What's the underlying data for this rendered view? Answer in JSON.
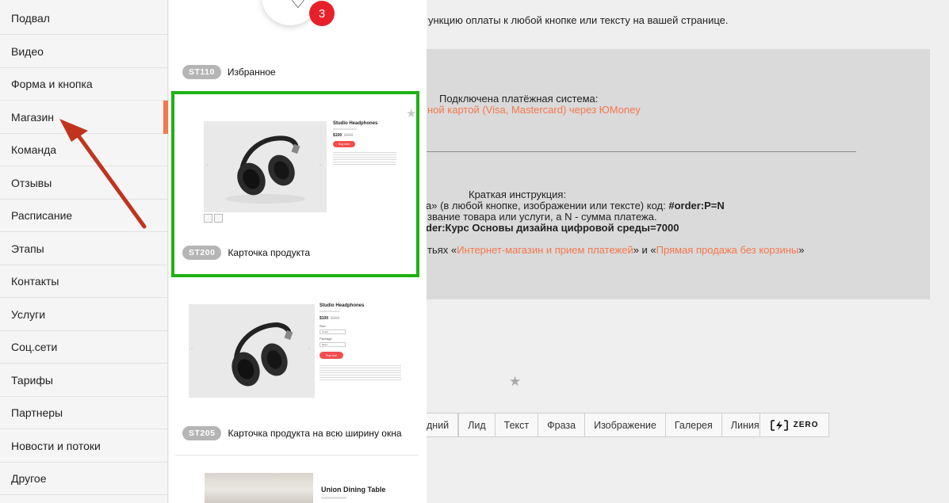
{
  "background_page": {
    "intro": "ункцию оплаты к любой кнопке или тексту на вашей странице.",
    "payment_heading": "Подключена платёжная система:",
    "payment_system": "ной картой (Visa, Mastercard) через ЮMoney",
    "instructions_heading": "Краткая инструкция:",
    "instr_line1_text": "а» (в любой кнопке, изображении или тексте) код: ",
    "instr_line1_code": "#order:P=N",
    "instr_line2": "звание товара или услуги, а N - сумма платежа.",
    "instr_line3": "der:Курс Основы дизайна цифровой среды=7000",
    "instr_line4_prefix": "тьях «",
    "instr_link1": "Интернет-магазин и прием платежей",
    "instr_line4_mid": "» и «",
    "instr_link2": "Прямая продажа без корзины",
    "instr_line4_suffix": "»",
    "toolbar": [
      "дний",
      "Лид",
      "Текст",
      "Фраза",
      "Изображение",
      "Галерея",
      "Линия"
    ],
    "zero_label": "ZERO",
    "accent_color": "#f4774b"
  },
  "sidebar": {
    "active_index": 3,
    "items": [
      "Подвал",
      "Видео",
      "Форма и кнопка",
      "Магазин",
      "Команда",
      "Отзывы",
      "Расписание",
      "Этапы",
      "Контакты",
      "Услуги",
      "Соц.сети",
      "Тарифы",
      "Партнеры",
      "Новости и потоки",
      "Другое"
    ]
  },
  "library": {
    "favorites_count": "3",
    "blocks": [
      {
        "code": "ST110",
        "title": "Избранное"
      },
      {
        "code": "ST200",
        "title": "Карточка продукта",
        "selected": true
      },
      {
        "code": "ST205",
        "title": "Карточка продукта на всю ширину окна"
      }
    ],
    "preview_st200": {
      "product_title": "Studio Headphones",
      "price": "$100",
      "old_price": "$200",
      "button": "Buy now"
    },
    "preview_st205": {
      "product_title": "Studio Headphones",
      "price": "$100",
      "old_price": "$200",
      "label_size": "Size",
      "select_size": "Small",
      "label_package": "Package",
      "select_package": "Basic",
      "button": "Buy now"
    },
    "preview_next": {
      "product_title": "Union Dining Table"
    },
    "selection_color": "#1fb113"
  },
  "annotation": {
    "type": "arrow",
    "color": "#c0341d"
  }
}
